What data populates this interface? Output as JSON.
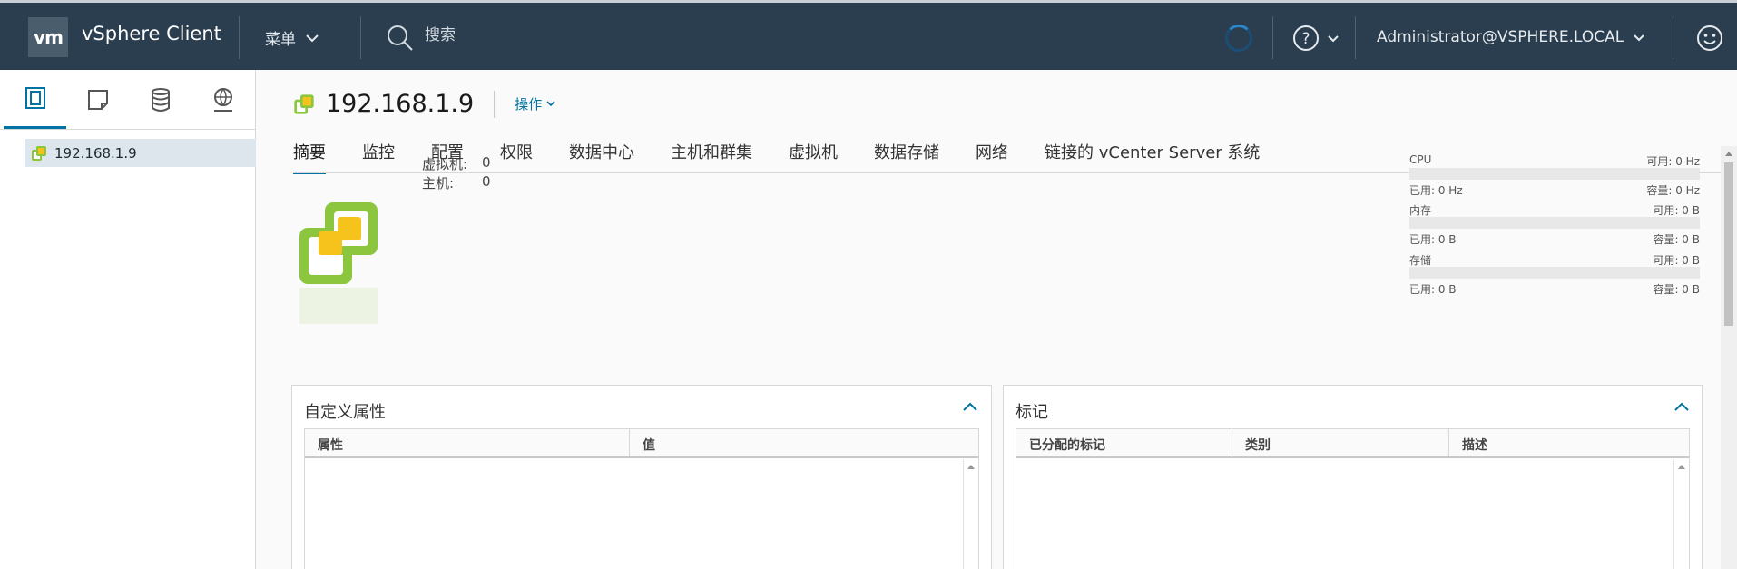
{
  "header": {
    "logo": "vm",
    "app_title": "vSphere Client",
    "menu_label": "菜单",
    "search_placeholder": "搜索",
    "user": "Administrator@VSPHERE.LOCAL",
    "icons": [
      "search-icon",
      "help-icon",
      "chevron-down-icon",
      "smiley-icon"
    ]
  },
  "sidebar": {
    "tabs": [
      "hosts-clusters-icon",
      "vms-templates-icon",
      "storage-icon",
      "networking-icon"
    ],
    "tree": [
      {
        "label": "192.168.1.9",
        "icon": "vcenter-icon"
      }
    ]
  },
  "object": {
    "title": "192.168.1.9",
    "actions_label": "操作"
  },
  "tabs": [
    "摘要",
    "监控",
    "配置",
    "权限",
    "数据中心",
    "主机和群集",
    "虚拟机",
    "数据存储",
    "网络",
    "链接的 vCenter Server 系统"
  ],
  "summary": {
    "vm_label": "虚拟机:",
    "vm_count": "0",
    "host_label": "主机:",
    "host_count": "0"
  },
  "resources": [
    {
      "name": "CPU",
      "free": "可用: 0 Hz",
      "used": "已用: 0 Hz",
      "capacity": "容量: 0 Hz",
      "usage": 0
    },
    {
      "name": "内存",
      "free": "可用: 0 B",
      "used": "已用: 0 B",
      "capacity": "容量: 0 B",
      "usage": 0
    },
    {
      "name": "存储",
      "free": "可用: 0 B",
      "used": "已用: 0 B",
      "capacity": "容量: 0 B",
      "usage": 0
    }
  ],
  "custom_attributes": {
    "title": "自定义属性",
    "columns": [
      "属性",
      "值"
    ]
  },
  "tags": {
    "title": "标记",
    "columns": [
      "已分配的标记",
      "类别",
      "描述"
    ]
  },
  "colors": {
    "header_bg": "#2b3e50",
    "accent": "#0072a3",
    "vcenter_green": "#8cc63f",
    "vcenter_yellow": "#f6c21c"
  }
}
